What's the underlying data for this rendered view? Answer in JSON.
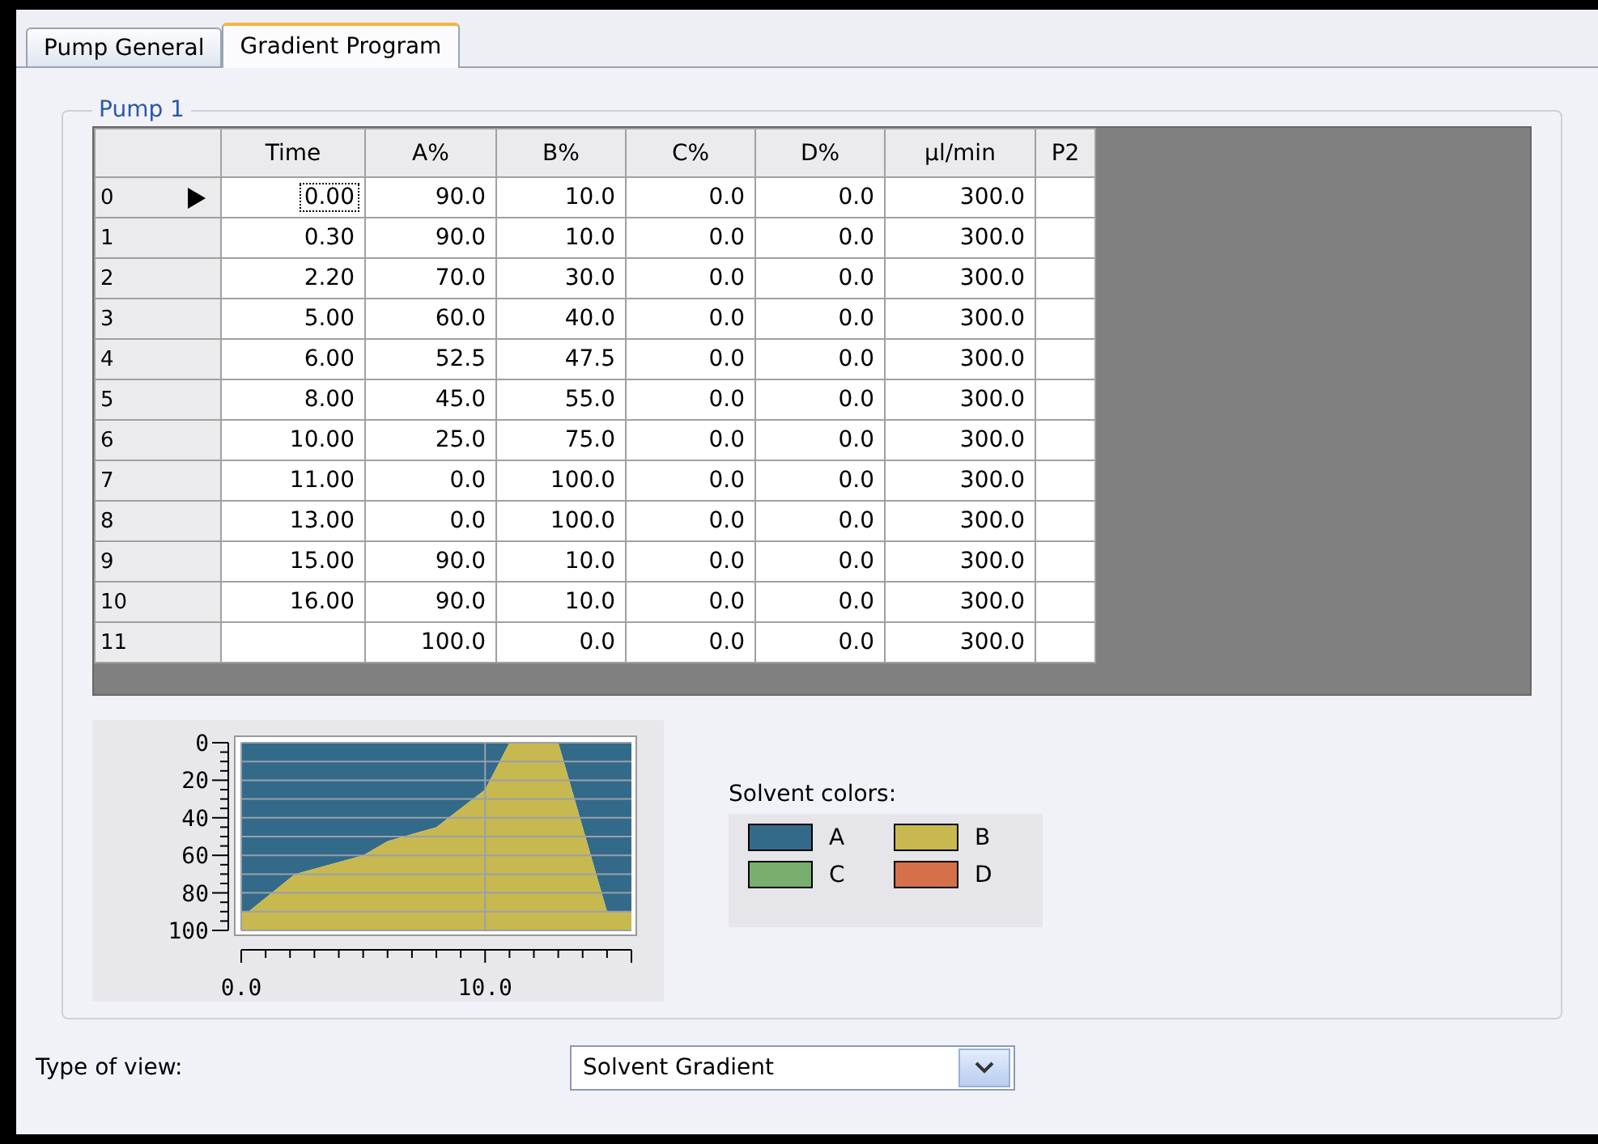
{
  "tabs": [
    {
      "label": "Pump General",
      "selected": false
    },
    {
      "label": "Gradient Program",
      "selected": true
    }
  ],
  "group": {
    "title": "Pump 1"
  },
  "table": {
    "columns": [
      "Time",
      "A%",
      "B%",
      "C%",
      "D%",
      "µl/min",
      "P2"
    ],
    "rows": [
      {
        "index": "0",
        "current": true,
        "cells": [
          "0.00",
          "90.0",
          "10.0",
          "0.0",
          "0.0",
          "300.0",
          ""
        ]
      },
      {
        "index": "1",
        "current": false,
        "cells": [
          "0.30",
          "90.0",
          "10.0",
          "0.0",
          "0.0",
          "300.0",
          ""
        ]
      },
      {
        "index": "2",
        "current": false,
        "cells": [
          "2.20",
          "70.0",
          "30.0",
          "0.0",
          "0.0",
          "300.0",
          ""
        ]
      },
      {
        "index": "3",
        "current": false,
        "cells": [
          "5.00",
          "60.0",
          "40.0",
          "0.0",
          "0.0",
          "300.0",
          ""
        ]
      },
      {
        "index": "4",
        "current": false,
        "cells": [
          "6.00",
          "52.5",
          "47.5",
          "0.0",
          "0.0",
          "300.0",
          ""
        ]
      },
      {
        "index": "5",
        "current": false,
        "cells": [
          "8.00",
          "45.0",
          "55.0",
          "0.0",
          "0.0",
          "300.0",
          ""
        ]
      },
      {
        "index": "6",
        "current": false,
        "cells": [
          "10.00",
          "25.0",
          "75.0",
          "0.0",
          "0.0",
          "300.0",
          ""
        ]
      },
      {
        "index": "7",
        "current": false,
        "cells": [
          "11.00",
          "0.0",
          "100.0",
          "0.0",
          "0.0",
          "300.0",
          ""
        ]
      },
      {
        "index": "8",
        "current": false,
        "cells": [
          "13.00",
          "0.0",
          "100.0",
          "0.0",
          "0.0",
          "300.0",
          ""
        ]
      },
      {
        "index": "9",
        "current": false,
        "cells": [
          "15.00",
          "90.0",
          "10.0",
          "0.0",
          "0.0",
          "300.0",
          ""
        ]
      },
      {
        "index": "10",
        "current": false,
        "cells": [
          "16.00",
          "90.0",
          "10.0",
          "0.0",
          "0.0",
          "300.0",
          ""
        ]
      },
      {
        "index": "11",
        "current": false,
        "cells": [
          "",
          "100.0",
          "0.0",
          "0.0",
          "0.0",
          "300.0",
          ""
        ]
      }
    ]
  },
  "gradient_chart": {
    "chart_data": {
      "type": "area",
      "stacked": true,
      "x": [
        0,
        0.3,
        2.2,
        5,
        6,
        8,
        10,
        11,
        13,
        15,
        16
      ],
      "series": [
        {
          "name": "A",
          "color": "#336a8a",
          "values": [
            90,
            90,
            70,
            60,
            52.5,
            45,
            25,
            0,
            0,
            90,
            90
          ]
        },
        {
          "name": "B",
          "color": "#c8b850",
          "values": [
            10,
            10,
            30,
            40,
            47.5,
            55,
            75,
            100,
            100,
            10,
            10
          ]
        }
      ],
      "grid": true,
      "xlim": [
        0,
        16
      ],
      "ylim": [
        100,
        0
      ],
      "xticks": [
        {
          "value": 0,
          "label": "0.0"
        },
        {
          "value": 10,
          "label": "10.0"
        }
      ],
      "yticks": [
        0,
        20,
        40,
        60,
        80,
        100
      ]
    },
    "legend_title": "Solvent colors:",
    "legend_extra_items": [
      {
        "label": "C",
        "color": "#7aae6e"
      },
      {
        "label": "D",
        "color": "#d4704a"
      }
    ]
  },
  "view": {
    "label": "Type of view:",
    "value": "Solvent Gradient"
  }
}
